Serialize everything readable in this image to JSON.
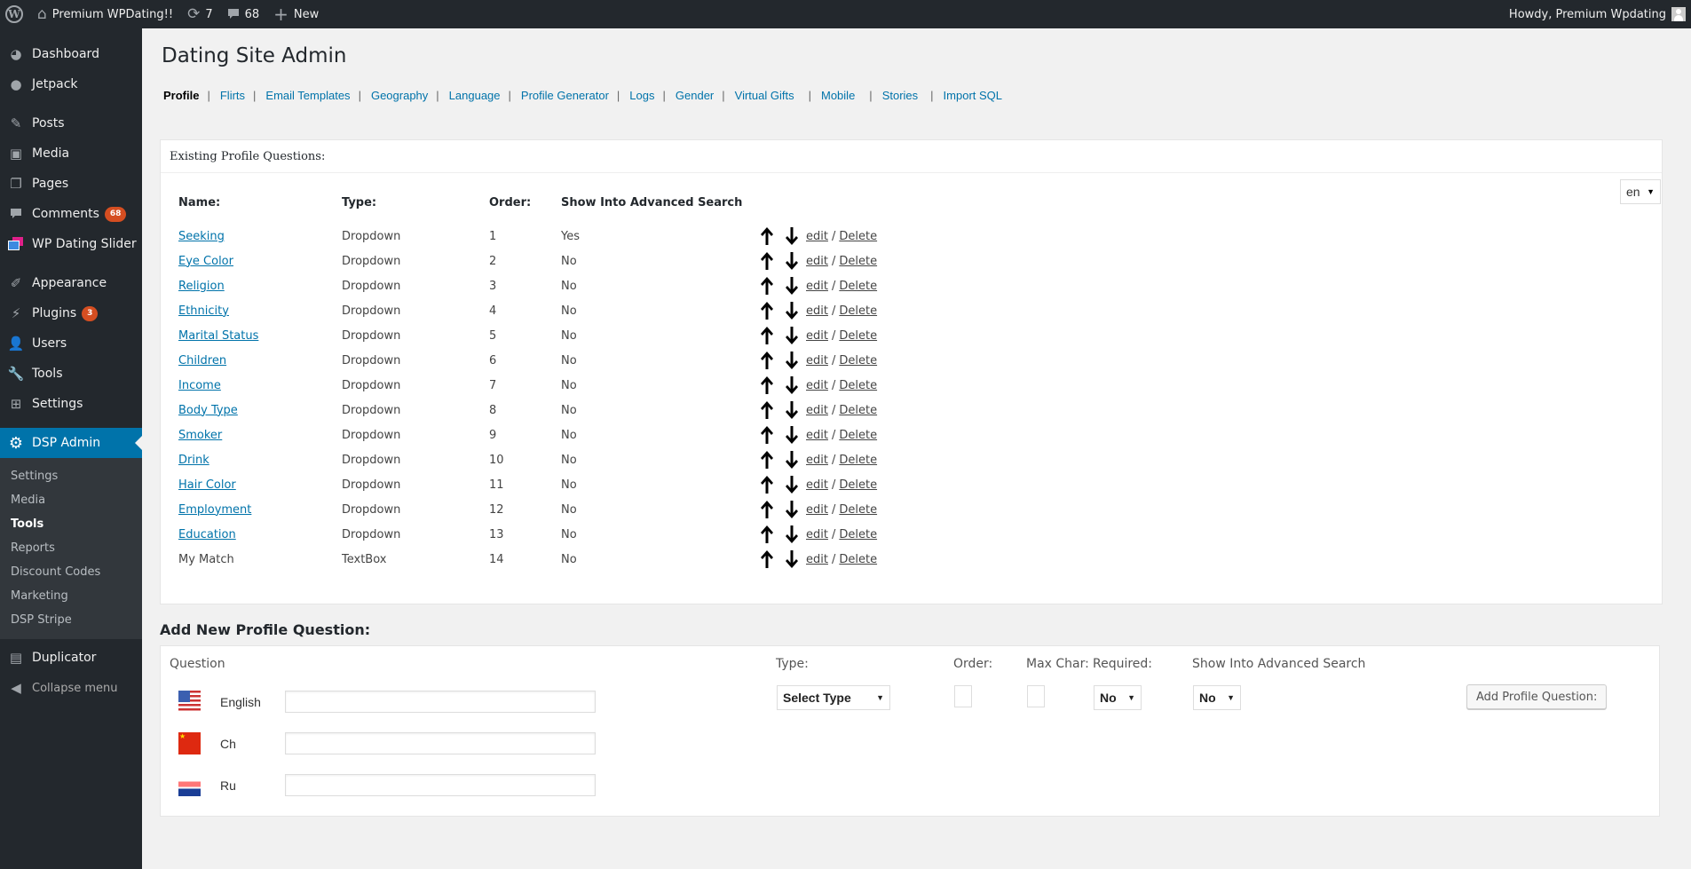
{
  "adminbar": {
    "site_name": "Premium WPDating!!",
    "updates_count": "7",
    "comments_count": "68",
    "new_label": "New",
    "greeting": "Howdy, Premium Wpdating"
  },
  "sidebar": {
    "items": [
      {
        "label": "Dashboard",
        "icon": "dashboard-icon"
      },
      {
        "label": "Jetpack",
        "icon": "jetpack-icon"
      },
      {
        "label": "Posts",
        "icon": "pin-icon"
      },
      {
        "label": "Media",
        "icon": "media-icon"
      },
      {
        "label": "Pages",
        "icon": "pages-icon"
      },
      {
        "label": "Comments",
        "icon": "comment-icon",
        "badge": "68"
      },
      {
        "label": "WP Dating Slider",
        "icon": "slider-icon"
      },
      {
        "label": "Appearance",
        "icon": "brush-icon"
      },
      {
        "label": "Plugins",
        "icon": "plugin-icon",
        "badge": "3"
      },
      {
        "label": "Users",
        "icon": "user-icon"
      },
      {
        "label": "Tools",
        "icon": "wrench-icon"
      },
      {
        "label": "Settings",
        "icon": "settings-icon"
      },
      {
        "label": "DSP Admin",
        "icon": "gear-icon"
      }
    ],
    "submenu": [
      "Settings",
      "Media",
      "Tools",
      "Reports",
      "Discount Codes",
      "Marketing",
      "DSP Stripe"
    ],
    "submenu_current": "Tools",
    "after": [
      {
        "label": "Duplicator",
        "icon": "duplicator-icon"
      },
      {
        "label": "Collapse menu",
        "icon": "collapse-icon"
      }
    ]
  },
  "page": {
    "title": "Dating Site Admin",
    "tabs": [
      "Profile",
      "Flirts",
      "Email Templates",
      "Geography",
      "Language",
      "Profile Generator",
      "Logs",
      "Gender",
      "Virtual Gifts",
      "Mobile",
      "Stories",
      "Import SQL"
    ],
    "active_tab": "Profile"
  },
  "existing": {
    "header": "Existing Profile Questions:",
    "language": "en",
    "columns": {
      "name": "Name:",
      "type": "Type:",
      "order": "Order:",
      "adv": "Show Into Advanced Search"
    },
    "edit_label": "edit",
    "delete_label": "Delete",
    "rows": [
      {
        "name": "Seeking",
        "type": "Dropdown",
        "order": "1",
        "adv": "Yes",
        "link": true
      },
      {
        "name": "Eye Color",
        "type": "Dropdown",
        "order": "2",
        "adv": "No",
        "link": true
      },
      {
        "name": "Religion",
        "type": "Dropdown",
        "order": "3",
        "adv": "No",
        "link": true
      },
      {
        "name": "Ethnicity",
        "type": "Dropdown",
        "order": "4",
        "adv": "No",
        "link": true
      },
      {
        "name": "Marital Status",
        "type": "Dropdown",
        "order": "5",
        "adv": "No",
        "link": true
      },
      {
        "name": "Children",
        "type": "Dropdown",
        "order": "6",
        "adv": "No",
        "link": true
      },
      {
        "name": "Income",
        "type": "Dropdown",
        "order": "7",
        "adv": "No",
        "link": true
      },
      {
        "name": "Body Type",
        "type": "Dropdown",
        "order": "8",
        "adv": "No",
        "link": true
      },
      {
        "name": "Smoker",
        "type": "Dropdown",
        "order": "9",
        "adv": "No",
        "link": true
      },
      {
        "name": "Drink",
        "type": "Dropdown",
        "order": "10",
        "adv": "No",
        "link": true
      },
      {
        "name": "Hair Color",
        "type": "Dropdown",
        "order": "11",
        "adv": "No",
        "link": true
      },
      {
        "name": "Employment",
        "type": "Dropdown",
        "order": "12",
        "adv": "No",
        "link": true
      },
      {
        "name": "Education",
        "type": "Dropdown",
        "order": "13",
        "adv": "No",
        "link": true
      },
      {
        "name": "My Match",
        "type": "TextBox",
        "order": "14",
        "adv": "No",
        "link": false
      }
    ]
  },
  "add_new": {
    "title": "Add New Profile Question:",
    "question_label": "Question",
    "languages": [
      {
        "name": "English",
        "flag": "us-flag-icon",
        "value": ""
      },
      {
        "name": "Ch",
        "flag": "china-flag-icon",
        "value": ""
      },
      {
        "name": "Ru",
        "flag": "russia-flag-icon",
        "value": ""
      }
    ],
    "type_label": "Type:",
    "type_value": "Select Type",
    "order_label": "Order:",
    "order_value": "",
    "maxchar_label": "Max Char:",
    "maxchar_value": "",
    "required_label": "Required:",
    "required_value": "No",
    "adv_label": "Show Into Advanced Search",
    "adv_value": "No",
    "submit_label": "Add Profile Question:"
  }
}
